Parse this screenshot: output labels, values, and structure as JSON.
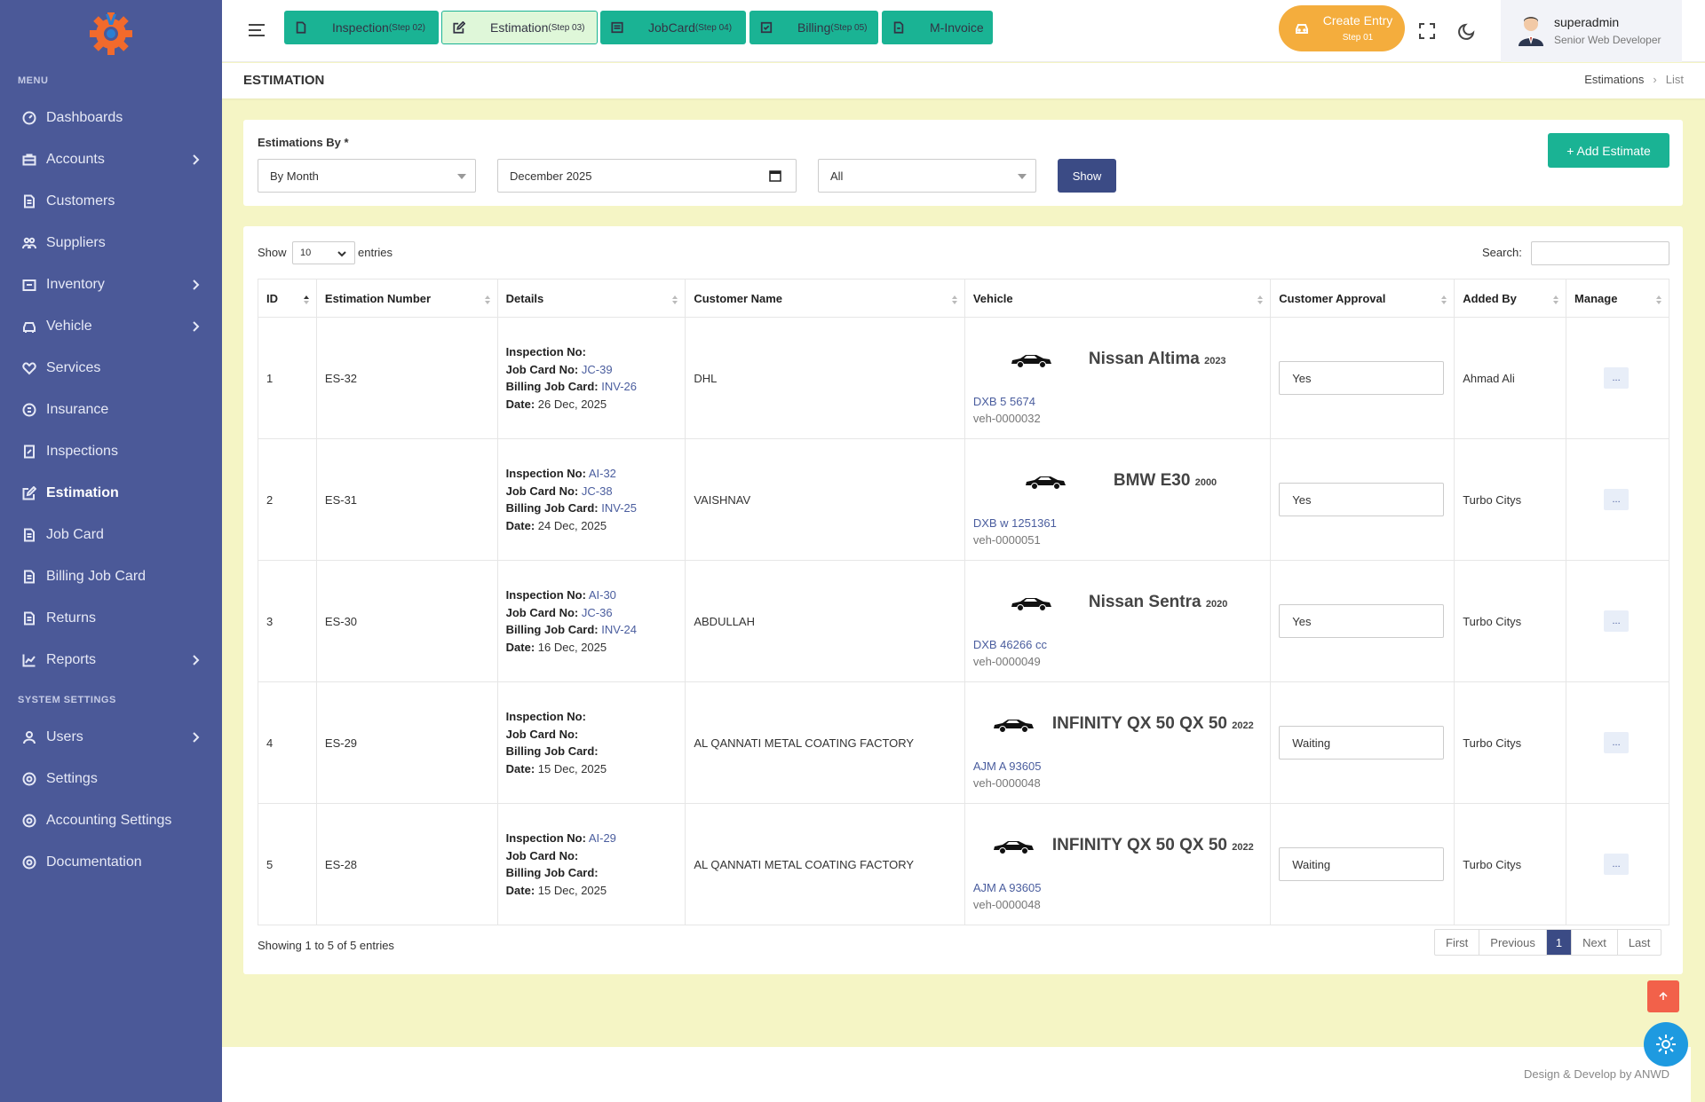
{
  "sidebar": {
    "menu_label": "MENU",
    "system_label": "SYSTEM SETTINGS",
    "items": [
      {
        "label": "Dashboards",
        "icon": "dashboard-icon"
      },
      {
        "label": "Accounts",
        "icon": "briefcase-icon",
        "expand": true
      },
      {
        "label": "Customers",
        "icon": "document-icon"
      },
      {
        "label": "Suppliers",
        "icon": "people-icon"
      },
      {
        "label": "Inventory",
        "icon": "box-icon",
        "expand": true
      },
      {
        "label": "Vehicle",
        "icon": "car-icon",
        "expand": true
      },
      {
        "label": "Services",
        "icon": "heart-icon"
      },
      {
        "label": "Insurance",
        "icon": "coin-icon"
      },
      {
        "label": "Inspections",
        "icon": "edit-icon"
      },
      {
        "label": "Estimation",
        "icon": "edit-square-icon",
        "active": true
      },
      {
        "label": "Job Card",
        "icon": "document-icon"
      },
      {
        "label": "Billing Job Card",
        "icon": "document-icon"
      },
      {
        "label": "Returns",
        "icon": "document-icon"
      },
      {
        "label": "Reports",
        "icon": "chart-icon",
        "expand": true
      }
    ],
    "system_items": [
      {
        "label": "Users",
        "icon": "user-icon",
        "expand": true
      },
      {
        "label": "Settings",
        "icon": "gear-icon"
      },
      {
        "label": "Accounting Settings",
        "icon": "gear-icon"
      },
      {
        "label": "Documentation",
        "icon": "gear-icon"
      }
    ]
  },
  "topbar": {
    "steps": [
      {
        "label": "Inspection",
        "step": "(Step 02)"
      },
      {
        "label": "Estimation",
        "step": "(Step 03)"
      },
      {
        "label": "JobCard",
        "step": "(Step 04)"
      },
      {
        "label": "Billing",
        "step": "(Step 05)"
      },
      {
        "label": "M-Invoice",
        "step": ""
      }
    ],
    "create_entry": "Create Entry",
    "create_step": "Step 01",
    "user_name": "superadmin",
    "user_role": "Senior Web Developer"
  },
  "page": {
    "title": "ESTIMATION",
    "breadcrumb": [
      "Estimations",
      "List"
    ]
  },
  "filters": {
    "label": "Estimations By *",
    "by": "By Month",
    "month": "December 2025",
    "status": "All",
    "show_button": "Show",
    "add_button": "+ Add Estimate"
  },
  "table_controls": {
    "show_label": "Show",
    "entries_value": "10",
    "entries_label": "entries",
    "search_label": "Search:"
  },
  "table": {
    "columns": [
      "ID",
      "Estimation Number",
      "Details",
      "Customer Name",
      "Vehicle",
      "Customer Approval",
      "Added By",
      "Manage"
    ],
    "detail_labels": [
      "Inspection No:",
      "Job Card No:",
      "Billing Job Card:",
      "Date:"
    ],
    "rows": [
      {
        "id": "1",
        "number": "ES-32",
        "inspection": "",
        "jobcard": "JC-39",
        "billing": "INV-26",
        "date": "26 Dec, 2025",
        "customer": "DHL",
        "vehicle": "Nissan Altima",
        "year": "2023",
        "plate": "DXB 5 5674",
        "veh_id": "veh-0000032",
        "approval": "Yes",
        "added_by": "Ahmad Ali",
        "manage": "..."
      },
      {
        "id": "2",
        "number": "ES-31",
        "inspection": "AI-32",
        "jobcard": "JC-38",
        "billing": "INV-25",
        "date": "24 Dec, 2025",
        "customer": "VAISHNAV",
        "vehicle": "BMW E30",
        "year": "2000",
        "plate": "DXB w 1251361",
        "veh_id": "veh-0000051",
        "approval": "Yes",
        "added_by": "Turbo Citys",
        "manage": "..."
      },
      {
        "id": "3",
        "number": "ES-30",
        "inspection": "AI-30",
        "jobcard": "JC-36",
        "billing": "INV-24",
        "date": "16 Dec, 2025",
        "customer": "ABDULLAH",
        "vehicle": "Nissan Sentra",
        "year": "2020",
        "plate": "DXB 46266 cc",
        "veh_id": "veh-0000049",
        "approval": "Yes",
        "added_by": "Turbo Citys",
        "manage": "..."
      },
      {
        "id": "4",
        "number": "ES-29",
        "inspection": "",
        "jobcard": "",
        "billing": "",
        "date": "15 Dec, 2025",
        "customer": "AL QANNATI METAL COATING FACTORY",
        "vehicle": "INFINITY QX 50 QX 50",
        "year": "2022",
        "plate": "AJM A 93605",
        "veh_id": "veh-0000048",
        "approval": "Waiting",
        "added_by": "Turbo Citys",
        "manage": "..."
      },
      {
        "id": "5",
        "number": "ES-28",
        "inspection": "AI-29",
        "jobcard": "",
        "billing": "",
        "date": "15 Dec, 2025",
        "customer": "AL QANNATI METAL COATING FACTORY",
        "vehicle": "INFINITY QX 50 QX 50",
        "year": "2022",
        "plate": "AJM A 93605",
        "veh_id": "veh-0000048",
        "approval": "Waiting",
        "added_by": "Turbo Citys",
        "manage": "..."
      }
    ]
  },
  "footer_table": {
    "summary": "Showing 1 to 5 of 5 entries",
    "pager": [
      "First",
      "Previous",
      "1",
      "Next",
      "Last"
    ]
  },
  "footer": {
    "credit": "Design & Develop by ANWD"
  },
  "colors": {
    "sidebar": "#4b5998",
    "accent": "#1ab394",
    "primary": "#3b4b85",
    "orange": "#f4ad3d",
    "background": "#f5f5c5"
  }
}
